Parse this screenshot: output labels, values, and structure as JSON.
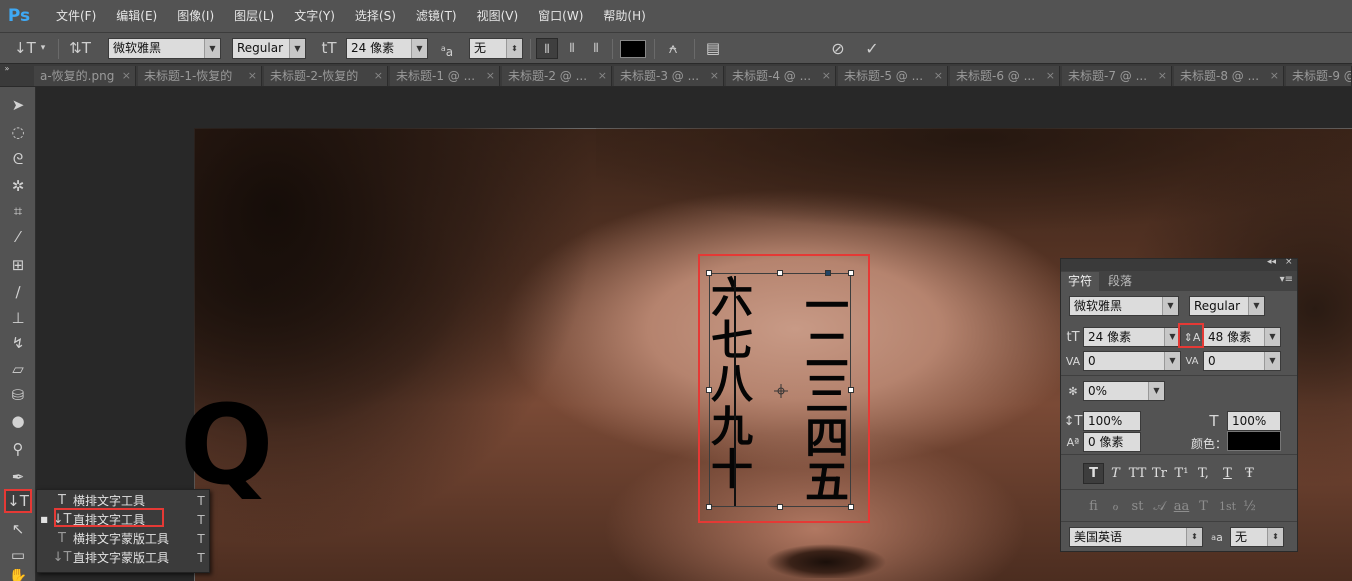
{
  "app": {
    "logo": "Ps"
  },
  "menu": [
    "文件(F)",
    "编辑(E)",
    "图像(I)",
    "图层(L)",
    "文字(Y)",
    "选择(S)",
    "滤镜(T)",
    "视图(V)",
    "窗口(W)",
    "帮助(H)"
  ],
  "options_bar": {
    "font_family": "微软雅黑",
    "font_style": "Regular",
    "font_size": "24 像素",
    "aa_label": "a",
    "aa_sub": "a",
    "antialias": "无",
    "color": "#000000"
  },
  "tabs": [
    "a-恢复的.png",
    "未标题-1-恢复的",
    "未标题-2-恢复的",
    "未标题-1 @ ...",
    "未标题-2 @ ...",
    "未标题-3 @ ...",
    "未标题-4 @ ...",
    "未标题-5 @ ...",
    "未标题-6 @ ...",
    "未标题-7 @ ...",
    "未标题-8 @ ...",
    "未标题-9 @"
  ],
  "canvas": {
    "column_right": [
      "一",
      "二",
      "三",
      "四",
      "五"
    ],
    "column_left": [
      "六",
      "七",
      "八",
      "九",
      "十"
    ],
    "stray_glyph": "Q"
  },
  "flyout": {
    "items": [
      {
        "label": "横排文字工具",
        "shortcut": "T",
        "selected": false
      },
      {
        "label": "直排文字工具",
        "shortcut": "T",
        "selected": true
      },
      {
        "label": "横排文字蒙版工具",
        "shortcut": "T",
        "selected": false
      },
      {
        "label": "直排文字蒙版工具",
        "shortcut": "T",
        "selected": false
      }
    ]
  },
  "char_panel": {
    "tab_character": "字符",
    "tab_paragraph": "段落",
    "font_family": "微软雅黑",
    "font_style": "Regular",
    "font_size": "24 像素",
    "leading": "48 像素",
    "kerning": "0",
    "tracking": "0",
    "tsume": "0%",
    "vertical_scale": "100%",
    "horizontal_scale": "100%",
    "baseline_shift": "0 像素",
    "color_label": "颜色：",
    "color": "#000000",
    "language": "美国英语",
    "aa_label": "a",
    "aa_sub": "a",
    "antialias": "无",
    "style_buttons": [
      "T",
      "T",
      "TT",
      "Tr",
      "T¹",
      "T,",
      "T",
      "Ŧ"
    ],
    "liga_buttons": [
      "fi",
      "ℴ",
      "st",
      "𝒜",
      "aa",
      "T",
      "1st",
      "½"
    ]
  }
}
